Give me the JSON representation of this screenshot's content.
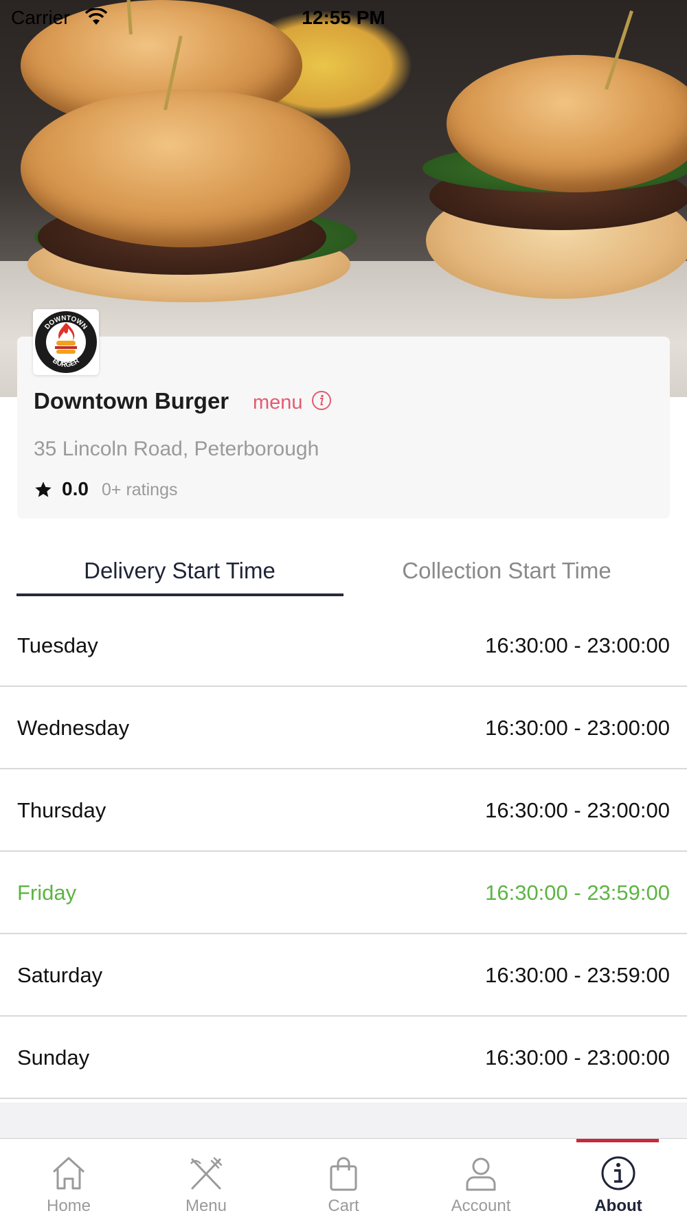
{
  "status_bar": {
    "carrier": "Carrier",
    "time": "12:55 PM"
  },
  "restaurant": {
    "name": "Downtown Burger",
    "menu_link": "menu",
    "address": "35 Lincoln Road, Peterborough",
    "rating": "0.0",
    "rating_count": "0+ ratings",
    "logo_text_top": "DOWNTOWN",
    "logo_text_bottom": "BURGER"
  },
  "tabs": [
    {
      "label": "Delivery Start Time",
      "active": true
    },
    {
      "label": "Collection Start Time",
      "active": false
    }
  ],
  "schedule": [
    {
      "day": "Tuesday",
      "hours": "16:30:00 - 23:00:00",
      "today": false
    },
    {
      "day": "Wednesday",
      "hours": "16:30:00 - 23:00:00",
      "today": false
    },
    {
      "day": "Thursday",
      "hours": "16:30:00 - 23:00:00",
      "today": false
    },
    {
      "day": "Friday",
      "hours": "16:30:00 - 23:59:00",
      "today": true
    },
    {
      "day": "Saturday",
      "hours": "16:30:00 - 23:59:00",
      "today": false
    },
    {
      "day": "Sunday",
      "hours": "16:30:00 - 23:00:00",
      "today": false
    }
  ],
  "bottom_nav": [
    {
      "label": "Home",
      "icon": "home-icon",
      "active": false
    },
    {
      "label": "Menu",
      "icon": "fork-knife-icon",
      "active": false
    },
    {
      "label": "Cart",
      "icon": "shopping-bag-icon",
      "active": false
    },
    {
      "label": "Account",
      "icon": "user-icon",
      "active": false
    },
    {
      "label": "About",
      "icon": "info-icon",
      "active": true
    }
  ],
  "colors": {
    "accent": "#e35b6e",
    "today": "#5db443",
    "tab_active": "#1e2437",
    "nav_active_bar": "#c9283b"
  }
}
